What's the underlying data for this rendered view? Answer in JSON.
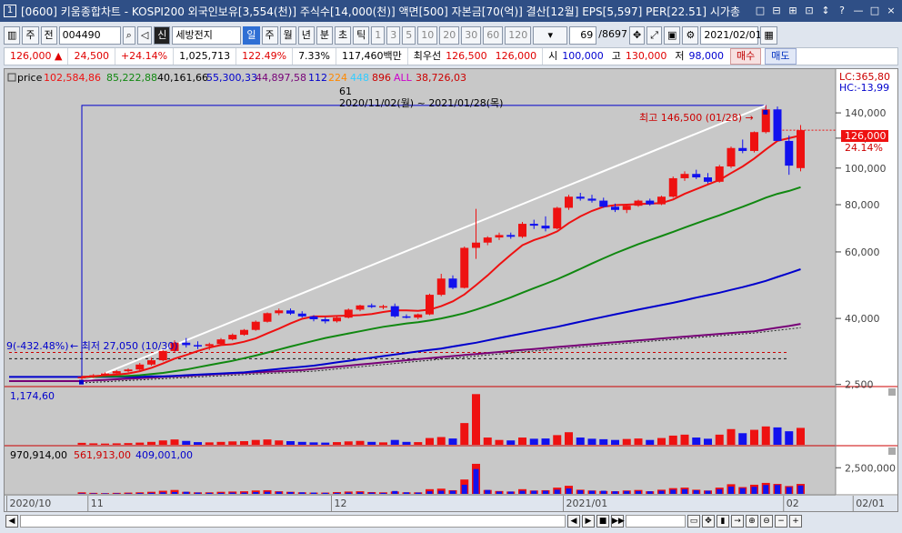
{
  "titlebar": {
    "number": "1",
    "title": "[0600] 키움종합차트 - KOSPI200 외국인보유[3,554(천)] 주식수[14,000(천)] 액면[500] 자본금[70(억)] 결산[12월] EPS[5,597] PER[22.51] 시가총",
    "buttons": [
      "□",
      "⊟",
      "⊞",
      "⊡",
      "↕",
      "?",
      "—",
      "□",
      "×"
    ]
  },
  "toolbar": {
    "period": "주",
    "prev": "전",
    "code": "004490",
    "stock_prefix": "신",
    "stock_name": "세방전지",
    "tf_day": "일",
    "tf_week": "주",
    "tf_month": "월",
    "tf_year": "년",
    "tf_min": "분",
    "tf_sec": "초",
    "tf_tick": "틱",
    "nums": [
      "1",
      "3",
      "5",
      "10",
      "20",
      "30",
      "60",
      "120"
    ],
    "count": "69",
    "total": "/8697",
    "date": "2021/02/01"
  },
  "pricebar": {
    "price": "126,000 ▲",
    "change": "24,500",
    "rate": "+24.14%",
    "volume": "1,025,713",
    "vol_ratio": "122.49%",
    "turnover": "7.33%",
    "amount": "117,460백만",
    "best_label": "최우선",
    "ask": "126,500",
    "bid": "126,000",
    "open_label": "시",
    "open": "100,000",
    "high_label": "고",
    "high": "130,000",
    "low_label": "저",
    "low": "98,000",
    "buy": "매수",
    "sell": "매도"
  },
  "legend": {
    "price": "price",
    "v1": "102,584,86",
    "v2": "85,222,88",
    "v3": "40,161,66",
    "v4": "55,300,33",
    "v5": "44,897,58",
    "v6": "112",
    "v7": "224",
    "v8": "448",
    "v9": "896",
    "v10": "ALL",
    "v11": "38,726,03",
    "lc": "LC:365,80",
    "hc": "HC:-13,99"
  },
  "annotations": {
    "count": "61",
    "range": "2020/11/02(월) ~ 2021/01/28(목)",
    "high": "최고 146,500 (01/28) →",
    "low_prefix": "9(-432.48%)",
    "low": "← 최저 27,050 (10/30)",
    "cur_price": "126,000",
    "cur_rate": "24.14%"
  },
  "volume_legend": "1,174,60",
  "trade_legend": {
    "a": "970,914,00",
    "b": "561,913,00",
    "c": "409,001,00"
  },
  "colors": {
    "up": "#ee1111",
    "down": "#1111ee",
    "ma5": "#ee1111",
    "ma20": "#118811",
    "ma60": "#0000cc",
    "ma120": "#770077",
    "bg": "#c8c8c8"
  },
  "chart_data": {
    "type": "candlestick",
    "price_axis": {
      "ticks": [
        40000,
        60000,
        80000,
        100000,
        120000,
        140000
      ],
      "labels": [
        "40,000",
        "60,000",
        "80,000",
        "100,000",
        "120,000",
        "140,000"
      ],
      "scale": "log",
      "range": [
        27000,
        160000
      ]
    },
    "volume_axis": {
      "ticks": [
        2500
      ],
      "labels": [
        "2,500"
      ]
    },
    "trade_axis": {
      "ticks": [
        2500000
      ],
      "labels": [
        "2,500,000"
      ]
    },
    "x_labels": [
      {
        "i": -6,
        "label": "2020/10"
      },
      {
        "i": 1,
        "label": "11"
      },
      {
        "i": 22,
        "label": "12"
      },
      {
        "i": 42,
        "label": "2021/01"
      },
      {
        "i": 61,
        "label": "02"
      },
      {
        "i": 67,
        "label": "02/01"
      }
    ],
    "candles": [
      [
        28000,
        28200,
        27050,
        28000
      ],
      [
        28000,
        28500,
        27800,
        28300
      ],
      [
        28300,
        28800,
        28100,
        28600
      ],
      [
        28600,
        29200,
        28400,
        29000
      ],
      [
        29000,
        29500,
        28800,
        29300
      ],
      [
        29300,
        30500,
        29100,
        30200
      ],
      [
        30200,
        31500,
        30000,
        31000
      ],
      [
        31000,
        33000,
        30800,
        32800
      ],
      [
        32800,
        35000,
        32500,
        34500
      ],
      [
        34500,
        35500,
        33500,
        34000
      ],
      [
        34000,
        34800,
        33200,
        33800
      ],
      [
        33800,
        34500,
        33000,
        34200
      ],
      [
        34200,
        35500,
        34000,
        35200
      ],
      [
        35200,
        36500,
        35000,
        36200
      ],
      [
        36200,
        37500,
        36000,
        37300
      ],
      [
        37300,
        39500,
        37100,
        39200
      ],
      [
        39200,
        41500,
        39000,
        41300
      ],
      [
        41300,
        42500,
        40800,
        42000
      ],
      [
        42000,
        42500,
        40900,
        41200
      ],
      [
        41200,
        41800,
        40200,
        40500
      ],
      [
        40500,
        40800,
        39300,
        39800
      ],
      [
        39800,
        40300,
        38800,
        39300
      ],
      [
        39300,
        40500,
        39000,
        40200
      ],
      [
        40200,
        42500,
        40000,
        42200
      ],
      [
        42200,
        43500,
        41800,
        43300
      ],
      [
        43300,
        43800,
        42600,
        42900
      ],
      [
        42900,
        43500,
        42300,
        43100
      ],
      [
        43100,
        43800,
        40200,
        40500
      ],
      [
        40500,
        41000,
        40000,
        40200
      ],
      [
        40200,
        41200,
        39800,
        41000
      ],
      [
        41000,
        46500,
        40800,
        46200
      ],
      [
        46200,
        52500,
        45800,
        51000
      ],
      [
        51000,
        52000,
        47800,
        48200
      ],
      [
        48200,
        62000,
        48000,
        61500
      ],
      [
        61500,
        78000,
        57500,
        63500
      ],
      [
        63500,
        66000,
        62500,
        65500
      ],
      [
        65500,
        67500,
        64500,
        66500
      ],
      [
        66500,
        67500,
        65000,
        65800
      ],
      [
        65800,
        72000,
        65300,
        71200
      ],
      [
        71200,
        73000,
        69000,
        70400
      ],
      [
        70400,
        74500,
        68000,
        69200
      ],
      [
        69200,
        79000,
        68800,
        78500
      ],
      [
        78500,
        85000,
        77500,
        84000
      ],
      [
        84000,
        86000,
        82000,
        83000
      ],
      [
        83000,
        85000,
        81000,
        82000
      ],
      [
        82000,
        83500,
        78500,
        79000
      ],
      [
        79000,
        80500,
        76500,
        77500
      ],
      [
        77500,
        80000,
        76000,
        79500
      ],
      [
        79500,
        82500,
        79000,
        82000
      ],
      [
        82000,
        83000,
        79500,
        80200
      ],
      [
        80200,
        84500,
        79800,
        84000
      ],
      [
        84000,
        95000,
        83500,
        94000
      ],
      [
        94000,
        98000,
        92500,
        96500
      ],
      [
        96500,
        99000,
        93500,
        94500
      ],
      [
        94500,
        97000,
        91000,
        92000
      ],
      [
        92000,
        102000,
        91500,
        101000
      ],
      [
        101000,
        114000,
        100000,
        113000
      ],
      [
        113000,
        119000,
        109500,
        111000
      ],
      [
        111000,
        125000,
        110000,
        124500
      ],
      [
        124500,
        146500,
        123500,
        143000
      ],
      [
        143000,
        145500,
        120000,
        118000
      ],
      [
        118000,
        122000,
        96000,
        101500
      ],
      [
        100000,
        130000,
        98000,
        126000
      ]
    ],
    "ma5": [
      28000,
      28100,
      28300,
      28400,
      28600,
      29000,
      29600,
      30400,
      31300,
      32000,
      32800,
      33500,
      34000,
      34200,
      34700,
      35400,
      36500,
      37600,
      38800,
      39900,
      40500,
      40500,
      40600,
      40700,
      40800,
      41100,
      41600,
      42000,
      42000,
      41900,
      42200,
      43100,
      44400,
      46300,
      49000,
      52000,
      55500,
      59000,
      62500,
      64500,
      66000,
      68000,
      71500,
      74500,
      77000,
      79000,
      79800,
      80000,
      80300,
      80500,
      80800,
      82600,
      85500,
      88000,
      90500,
      93000,
      97000,
      101000,
      106000,
      112000,
      118000,
      120000,
      122000
    ],
    "ma20": [
      28000,
      28000,
      28100,
      28100,
      28200,
      28300,
      28500,
      28700,
      29000,
      29300,
      29700,
      30100,
      30500,
      30900,
      31400,
      31900,
      32500,
      33100,
      33700,
      34300,
      34900,
      35500,
      36000,
      36500,
      37000,
      37500,
      38000,
      38400,
      38800,
      39100,
      39500,
      40000,
      40600,
      41300,
      42200,
      43200,
      44300,
      45500,
      46800,
      48100,
      49400,
      50800,
      52400,
      54100,
      55900,
      57700,
      59500,
      61200,
      62900,
      64500,
      66100,
      67800,
      69600,
      71400,
      73200,
      75000,
      77000,
      79000,
      81200,
      83500,
      85500,
      87000,
      89000
    ],
    "ma60": [
      28000,
      28000,
      28000,
      28000,
      28000,
      28000,
      28100,
      28100,
      28200,
      28300,
      28400,
      28500,
      28600,
      28700,
      28800,
      29000,
      29200,
      29400,
      29600,
      29800,
      30000,
      30300,
      30600,
      30900,
      31200,
      31500,
      31800,
      32100,
      32400,
      32700,
      33000,
      33300,
      33700,
      34100,
      34500,
      35000,
      35500,
      36000,
      36500,
      37000,
      37500,
      38000,
      38600,
      39200,
      39800,
      40400,
      41000,
      41600,
      42200,
      42800,
      43400,
      44000,
      44700,
      45400,
      46100,
      46800,
      47600,
      48400,
      49300,
      50300,
      51500,
      52700,
      54000
    ],
    "ma120": [
      27300,
      27400,
      27500,
      27600,
      27700,
      27800,
      27900,
      28000,
      28100,
      28200,
      28300,
      28400,
      28500,
      28600,
      28700,
      28800,
      28900,
      29000,
      29100,
      29200,
      29400,
      29600,
      29800,
      30000,
      30200,
      30400,
      30600,
      30800,
      31000,
      31200,
      31400,
      31600,
      31800,
      32000,
      32200,
      32400,
      32600,
      32800,
      33000,
      33200,
      33400,
      33600,
      33800,
      34000,
      34200,
      34400,
      34600,
      34800,
      35000,
      35200,
      35400,
      35600,
      35800,
      36000,
      36200,
      36400,
      36600,
      36800,
      37000,
      37400,
      37800,
      38200,
      38700
    ],
    "ma240": [
      27000,
      27100,
      27200,
      27300,
      27400,
      27500,
      27600,
      27700,
      27800,
      27900,
      28000,
      28100,
      28200,
      28300,
      28400,
      28500,
      28600,
      28700,
      28800,
      28900,
      29000,
      29200,
      29400,
      29600,
      29800,
      30000,
      30200,
      30400,
      30600,
      30800,
      31000,
      31200,
      31400,
      31600,
      31800,
      32000,
      32200,
      32400,
      32600,
      32800,
      33000,
      33200,
      33400,
      33600,
      33800,
      34000,
      34200,
      34400,
      34600,
      34800,
      35000,
      35200,
      35400,
      35600,
      35800,
      36000,
      36200,
      36400,
      36600,
      36900,
      37200,
      37500,
      37800
    ],
    "volume": [
      80,
      60,
      50,
      60,
      70,
      90,
      120,
      180,
      220,
      160,
      110,
      100,
      120,
      140,
      150,
      200,
      220,
      180,
      150,
      120,
      100,
      90,
      110,
      140,
      160,
      120,
      100,
      200,
      120,
      110,
      280,
      320,
      260,
      900,
      2100,
      300,
      200,
      180,
      300,
      250,
      260,
      400,
      520,
      300,
      250,
      230,
      200,
      240,
      260,
      200,
      280,
      380,
      420,
      300,
      250,
      420,
      650,
      480,
      620,
      760,
      720,
      560,
      700
    ],
    "trade": [
      [
        60,
        20
      ],
      [
        40,
        20
      ],
      [
        30,
        20
      ],
      [
        40,
        20
      ],
      [
        50,
        20
      ],
      [
        60,
        30
      ],
      [
        80,
        40
      ],
      [
        120,
        60
      ],
      [
        150,
        70
      ],
      [
        80,
        80
      ],
      [
        60,
        50
      ],
      [
        60,
        40
      ],
      [
        80,
        40
      ],
      [
        90,
        50
      ],
      [
        100,
        50
      ],
      [
        130,
        70
      ],
      [
        140,
        80
      ],
      [
        100,
        80
      ],
      [
        80,
        70
      ],
      [
        60,
        60
      ],
      [
        50,
        50
      ],
      [
        50,
        40
      ],
      [
        70,
        40
      ],
      [
        90,
        50
      ],
      [
        100,
        60
      ],
      [
        70,
        50
      ],
      [
        60,
        40
      ],
      [
        90,
        110
      ],
      [
        60,
        60
      ],
      [
        60,
        50
      ],
      [
        180,
        100
      ],
      [
        200,
        120
      ],
      [
        140,
        120
      ],
      [
        550,
        350
      ],
      [
        1150,
        950
      ],
      [
        150,
        150
      ],
      [
        110,
        90
      ],
      [
        90,
        90
      ],
      [
        180,
        120
      ],
      [
        130,
        120
      ],
      [
        140,
        120
      ],
      [
        240,
        160
      ],
      [
        310,
        210
      ],
      [
        160,
        140
      ],
      [
        130,
        120
      ],
      [
        110,
        120
      ],
      [
        100,
        100
      ],
      [
        130,
        110
      ],
      [
        150,
        110
      ],
      [
        100,
        100
      ],
      [
        160,
        120
      ],
      [
        220,
        160
      ],
      [
        240,
        180
      ],
      [
        160,
        140
      ],
      [
        130,
        120
      ],
      [
        240,
        180
      ],
      [
        370,
        280
      ],
      [
        260,
        220
      ],
      [
        350,
        270
      ],
      [
        420,
        340
      ],
      [
        380,
        340
      ],
      [
        300,
        260
      ],
      [
        380,
        320
      ]
    ]
  }
}
